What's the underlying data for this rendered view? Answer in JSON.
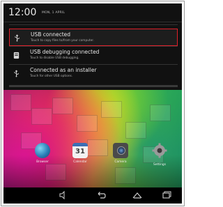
{
  "status": {
    "time": "12:00",
    "date": "MON, 1 APRIL"
  },
  "notifications": [
    {
      "title": "USB connected",
      "subtitle": "Touch to copy files to/from your computer.",
      "icon": "usb-icon"
    },
    {
      "title": "USB debugging connected",
      "subtitle": "Touch to disable USB debugging.",
      "icon": "debug-icon"
    },
    {
      "title": "Connected as an installer",
      "subtitle": "Touch for other USB options.",
      "icon": "usb-icon"
    }
  ],
  "home_apps": [
    {
      "label": "Browser",
      "icon": "globe-icon"
    },
    {
      "label": "Calendar",
      "icon": "calendar-icon",
      "badge": "31"
    },
    {
      "label": "Camera",
      "icon": "camera-icon"
    },
    {
      "label": "Settings",
      "icon": "gear-icon"
    }
  ],
  "navbar": {
    "buttons": [
      "volume-icon",
      "back-icon",
      "home-icon",
      "recents-icon"
    ]
  },
  "colors": {
    "highlight": "#e0202a",
    "shade_bg": "#111111",
    "nav_bg": "#000000"
  }
}
